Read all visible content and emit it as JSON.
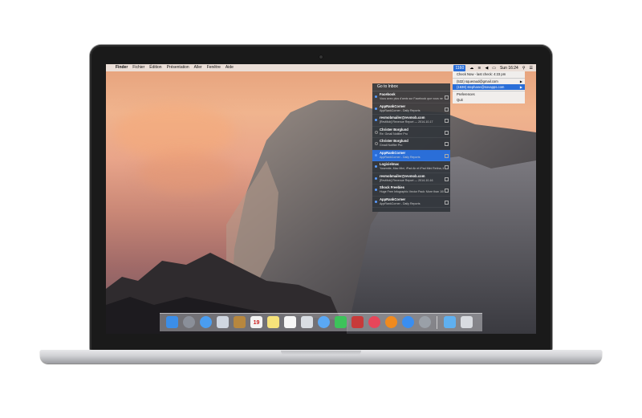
{
  "menubar": {
    "apple_icon": "apple-logo-icon",
    "items": [
      "Finder",
      "Fichier",
      "Édition",
      "Présentation",
      "Aller",
      "Fenêtre",
      "Aide"
    ],
    "status_badge": "1160",
    "datetime": "Sun 16:24"
  },
  "status_menu": {
    "items": [
      {
        "label": "Check Now - last check: 4:23 pm"
      },
      {
        "label": "(532) squeraud@gmail.com",
        "submenu": true
      },
      {
        "label": "(1638) stephane@sovapps.com",
        "submenu": true
      },
      {
        "label": "Preferences"
      },
      {
        "label": "Quit"
      }
    ]
  },
  "inbox_panel": {
    "header": "Go to Inbox",
    "mails": [
      {
        "sender": "Facebook",
        "subject": "Vous avez plus d'amis sur Facebook que vous ne le pen…",
        "unread": true
      },
      {
        "sender": "AppRankCorner",
        "subject": "AppRankCorner - Daily Reports",
        "unread": true
      },
      {
        "sender": "revmobmailer@revmob.com",
        "subject": "[RevMob] Revenue Report — 2014-10-17",
        "unread": true
      },
      {
        "sender": "Christer Borglund",
        "subject": "Re: Gmail Notifier Pro",
        "unread": false
      },
      {
        "sender": "Christer Borglund",
        "subject": "Gmail Notifier Pro",
        "unread": false
      },
      {
        "sender": "AppRankCorner",
        "subject": "AppRankCorner - Daily Reports",
        "unread": true,
        "selected": true
      },
      {
        "sender": "Logicielmac",
        "subject": "Yosemite, Mac Mini, iPad Air et iPad Mini Retina, iMac…",
        "unread": true
      },
      {
        "sender": "revmobmailer@revmob.com",
        "subject": "[RevMob] Revenue Report — 2014-10-16",
        "unread": true
      },
      {
        "sender": "Shock Freebies",
        "subject": "Huge Free Infographic Vector Pack: More than 100 Eleme…",
        "unread": true
      },
      {
        "sender": "AppRankCorner",
        "subject": "AppRankCorner - Daily Reports",
        "unread": true
      }
    ]
  },
  "dock": {
    "apps": [
      {
        "name": "finder-icon",
        "color": "#3b8ee8"
      },
      {
        "name": "launchpad-icon",
        "color": "#8a8f99"
      },
      {
        "name": "safari-icon",
        "color": "#4a9df0"
      },
      {
        "name": "mail-icon",
        "color": "#cfd6e0"
      },
      {
        "name": "contacts-icon",
        "color": "#b7873e"
      },
      {
        "name": "calendar-icon",
        "color": "#f4f4f4",
        "text": "19"
      },
      {
        "name": "notes-icon",
        "color": "#f6e27a"
      },
      {
        "name": "reminders-icon",
        "color": "#f7f7f7"
      },
      {
        "name": "preview-icon",
        "color": "#d9dde3"
      },
      {
        "name": "messages-icon",
        "color": "#5aa8f5"
      },
      {
        "name": "facetime-icon",
        "color": "#3cc35a"
      },
      {
        "name": "photo-booth-icon",
        "color": "#c73a3a"
      },
      {
        "name": "itunes-icon",
        "color": "#e6465a"
      },
      {
        "name": "ibooks-icon",
        "color": "#f08a1e"
      },
      {
        "name": "app-store-icon",
        "color": "#3a8ef0"
      },
      {
        "name": "system-preferences-icon",
        "color": "#9aa0a8"
      },
      {
        "name": "downloads-folder-icon",
        "color": "#5fb0f0"
      },
      {
        "name": "trash-icon",
        "color": "#d8dbe0"
      }
    ]
  }
}
